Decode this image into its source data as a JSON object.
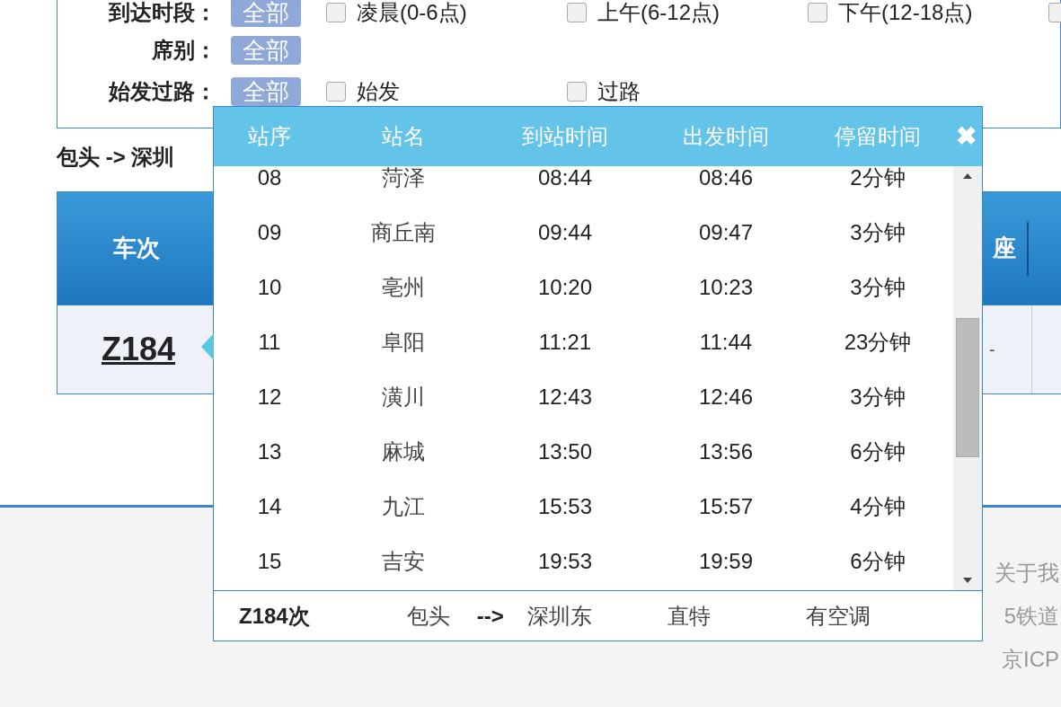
{
  "filters": [
    {
      "label": "到达时段：",
      "badge": "全部",
      "badge_selected": true,
      "options": [
        {
          "label": "凌晨(0-6点)",
          "checked": false
        },
        {
          "label": "上午(6-12点)",
          "checked": false
        },
        {
          "label": "下午(12-18点)",
          "checked": false
        },
        {
          "checked": false
        }
      ]
    },
    {
      "label": "席别：",
      "badge": "全部",
      "badge_selected": true
    },
    {
      "label": "始发过路：",
      "badge": "全部",
      "badge_selected": true,
      "options": [
        {
          "label": "始发",
          "checked": false
        },
        {
          "label": "过路",
          "checked": false
        }
      ]
    }
  ],
  "route_title": "包头 -> 深圳",
  "table": {
    "columns": [
      "车次",
      "座"
    ],
    "rows": [
      {
        "train": "Z184",
        "cell_2": "-"
      }
    ]
  },
  "footer": [
    "关于我",
    "5铁道",
    "京ICP"
  ],
  "popup": {
    "columns": [
      "站序",
      "站名",
      "到站时间",
      "出发时间",
      "停留时间"
    ],
    "close": "✖",
    "rows": [
      {
        "no": "08",
        "station": "菏泽",
        "arrive": "08:44",
        "depart": "08:46",
        "stop": "2分钟"
      },
      {
        "no": "09",
        "station": "商丘南",
        "arrive": "09:44",
        "depart": "09:47",
        "stop": "3分钟"
      },
      {
        "no": "10",
        "station": "亳州",
        "arrive": "10:20",
        "depart": "10:23",
        "stop": "3分钟"
      },
      {
        "no": "11",
        "station": "阜阳",
        "arrive": "11:21",
        "depart": "11:44",
        "stop": "23分钟"
      },
      {
        "no": "12",
        "station": "潢川",
        "arrive": "12:43",
        "depart": "12:46",
        "stop": "3分钟"
      },
      {
        "no": "13",
        "station": "麻城",
        "arrive": "13:50",
        "depart": "13:56",
        "stop": "6分钟"
      },
      {
        "no": "14",
        "station": "九江",
        "arrive": "15:53",
        "depart": "15:57",
        "stop": "4分钟"
      },
      {
        "no": "15",
        "station": "吉安",
        "arrive": "19:53",
        "depart": "19:59",
        "stop": "6分钟"
      }
    ],
    "summary": {
      "train": "Z184次",
      "from": "包头",
      "arrow": "-->",
      "to": "深圳东",
      "type": "直特",
      "aircon": "有空调"
    }
  }
}
